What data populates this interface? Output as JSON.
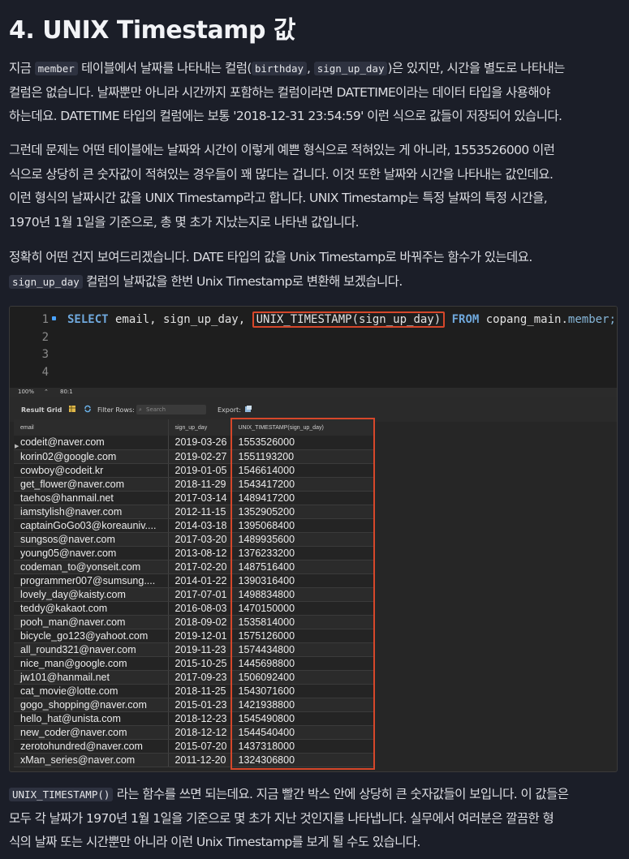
{
  "heading": "4. UNIX Timestamp 값",
  "para1": {
    "l1_a": "지금 ",
    "code_member": "member",
    "l1_b": " 테이블에서 날짜를 나타내는 컬럼(",
    "code_birthday": "birthday",
    "l1_c": ", ",
    "code_signup": "sign_up_day",
    "l1_d": ")은 있지만, 시간을 별도로 나타내는",
    "l2": "컬럼은 없습니다. 날짜뿐만 아니라 시간까지 포함하는 컬럼이라면 DATETIME이라는 데이터 타입을 사용해야",
    "l3": "하는데요. DATETIME 타입의 컬럼에는 보통 '2018-12-31 23:54:59' 이런 식으로 값들이 저장되어 있습니다."
  },
  "para2": {
    "l1": "그런데 문제는 어떤 테이블에는 날짜와 시간이 이렇게 예쁜 형식으로 적혀있는 게 아니라, 1553526000 이런",
    "l2": "식으로 상당히 큰 숫자값이 적혀있는 경우들이 꽤 많다는 겁니다. 이것 또한 날짜와 시간을 나타내는 값인데요.",
    "l3": "이런 형식의 날짜시간 값을 UNIX Timestamp라고 합니다. UNIX Timestamp는 특정 날짜의 특정 시간을,",
    "l4": "1970년 1월 1일을 기준으로, 총 몇 초가 지났는지로 나타낸 값입니다."
  },
  "para3": {
    "l1": "정확히 어떤 건지 보여드리겠습니다. DATE 타입의 값을 Unix Timestamp로 바꿔주는 함수가 있는데요.",
    "code_signup": "sign_up_day",
    "l2_rest": " 컬럼의 날짜값을 한번 Unix Timestamp로 변환해 보겠습니다."
  },
  "editor": {
    "line_numbers": [
      "1",
      "2",
      "3",
      "4"
    ],
    "kw_select": "SELECT",
    "cols": " email, sign_up_day, ",
    "fn": "UNIX_TIMESTAMP(sign_up_day)",
    "kw_from": " FROM",
    "table_schema": " copang_main.",
    "table_name": "member;"
  },
  "statusbar": {
    "zoom": "100%",
    "position": "80:1"
  },
  "gridbar": {
    "result_grid": "Result Grid",
    "filter_rows": "Filter Rows:",
    "search_placeholder": "Search",
    "export": "Export:"
  },
  "table": {
    "headers": [
      "email",
      "sign_up_day",
      "UNIX_TIMESTAMP(sign_up_day)"
    ],
    "rows": [
      [
        "codeit@naver.com",
        "2019-03-26",
        "1553526000"
      ],
      [
        "korin02@google.com",
        "2019-02-27",
        "1551193200"
      ],
      [
        "cowboy@codeit.kr",
        "2019-01-05",
        "1546614000"
      ],
      [
        "get_flower@naver.com",
        "2018-11-29",
        "1543417200"
      ],
      [
        "taehos@hanmail.net",
        "2017-03-14",
        "1489417200"
      ],
      [
        "iamstylish@naver.com",
        "2012-11-15",
        "1352905200"
      ],
      [
        "captainGoGo03@koreauniv....",
        "2014-03-18",
        "1395068400"
      ],
      [
        "sungsos@naver.com",
        "2017-03-20",
        "1489935600"
      ],
      [
        "young05@naver.com",
        "2013-08-12",
        "1376233200"
      ],
      [
        "codeman_to@yonseit.com",
        "2017-02-20",
        "1487516400"
      ],
      [
        "programmer007@sumsung....",
        "2014-01-22",
        "1390316400"
      ],
      [
        "lovely_day@kaisty.com",
        "2017-07-01",
        "1498834800"
      ],
      [
        "teddy@kakaot.com",
        "2016-08-03",
        "1470150000"
      ],
      [
        "pooh_man@naver.com",
        "2018-09-02",
        "1535814000"
      ],
      [
        "bicycle_go123@yahoot.com",
        "2019-12-01",
        "1575126000"
      ],
      [
        "all_round321@naver.com",
        "2019-11-23",
        "1574434800"
      ],
      [
        "nice_man@google.com",
        "2015-10-25",
        "1445698800"
      ],
      [
        "jw101@hanmail.net",
        "2017-09-23",
        "1506092400"
      ],
      [
        "cat_movie@lotte.com",
        "2018-11-25",
        "1543071600"
      ],
      [
        "gogo_shopping@naver.com",
        "2015-01-23",
        "1421938800"
      ],
      [
        "hello_hat@unista.com",
        "2018-12-23",
        "1545490800"
      ],
      [
        "new_coder@naver.com",
        "2018-12-12",
        "1544540400"
      ],
      [
        "zerotohundred@naver.com",
        "2015-07-20",
        "1437318000"
      ],
      [
        "xMan_series@naver.com",
        "2011-12-20",
        "1324306800"
      ]
    ]
  },
  "para4": {
    "code_fn": "UNIX_TIMESTAMP()",
    "l1_rest": " 라는 함수를 쓰면 되는데요. 지금 빨간 박스 안에 상당히 큰 숫자값들이 보입니다. 이 값들은",
    "l2": "모두 각 날짜가 1970년 1월 1일을 기준으로 몇 초가 지난 것인지를 나타냅니다. 실무에서 여러분은 깔끔한 형",
    "l3": "식의 날짜 또는 시간뿐만 아니라 이런 Unix Timestamp를 보게 될 수도 있습니다."
  },
  "colors": {
    "background": "#1b1e28",
    "highlight_red": "#d6472a"
  }
}
